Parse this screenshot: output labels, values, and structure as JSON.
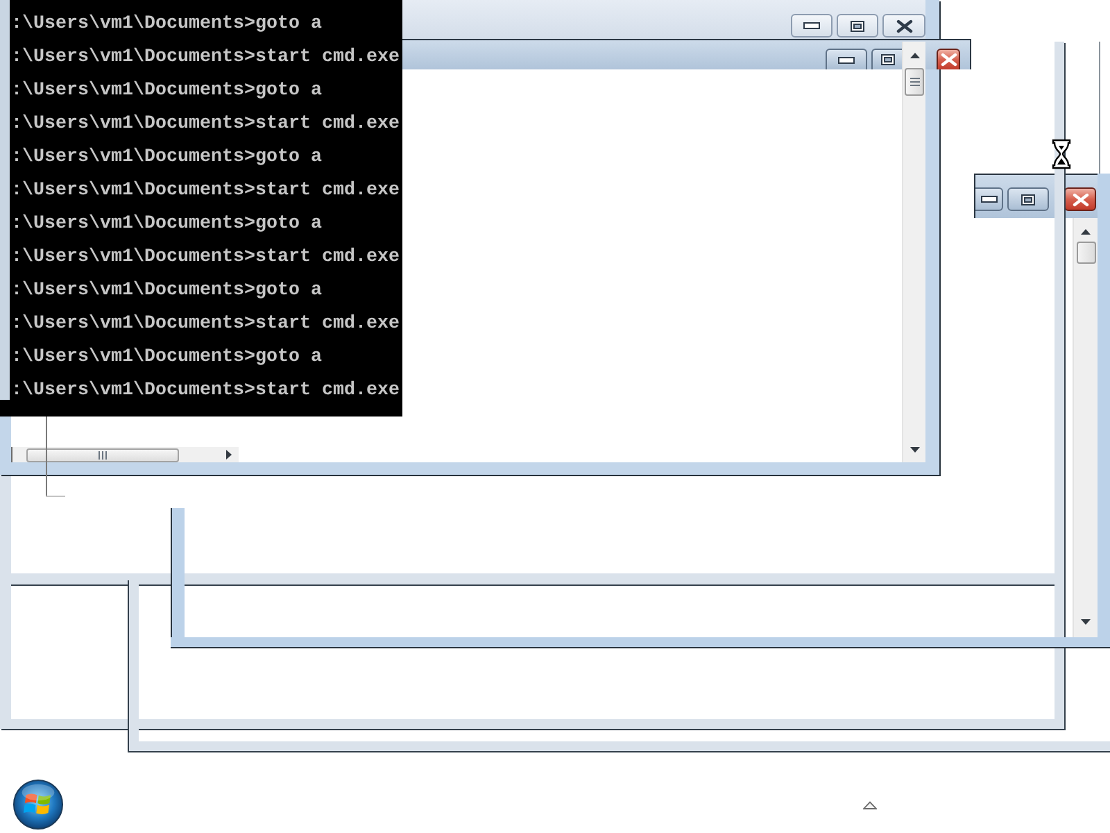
{
  "console": {
    "lines": [
      ":\\Users\\vm1\\Documents>goto a",
      ":\\Users\\vm1\\Documents>start cmd.exe",
      ":\\Users\\vm1\\Documents>goto a",
      ":\\Users\\vm1\\Documents>start cmd.exe",
      ":\\Users\\vm1\\Documents>goto a",
      ":\\Users\\vm1\\Documents>start cmd.exe",
      ":\\Users\\vm1\\Documents>goto a",
      ":\\Users\\vm1\\Documents>start cmd.exe",
      ":\\Users\\vm1\\Documents>goto a",
      ":\\Users\\vm1\\Documents>start cmd.exe",
      ":\\Users\\vm1\\Documents>goto a",
      ":\\Users\\vm1\\Documents>start cmd.exe"
    ]
  },
  "windows": [
    {
      "active": false
    },
    {
      "active": true
    },
    {
      "active": true
    }
  ]
}
